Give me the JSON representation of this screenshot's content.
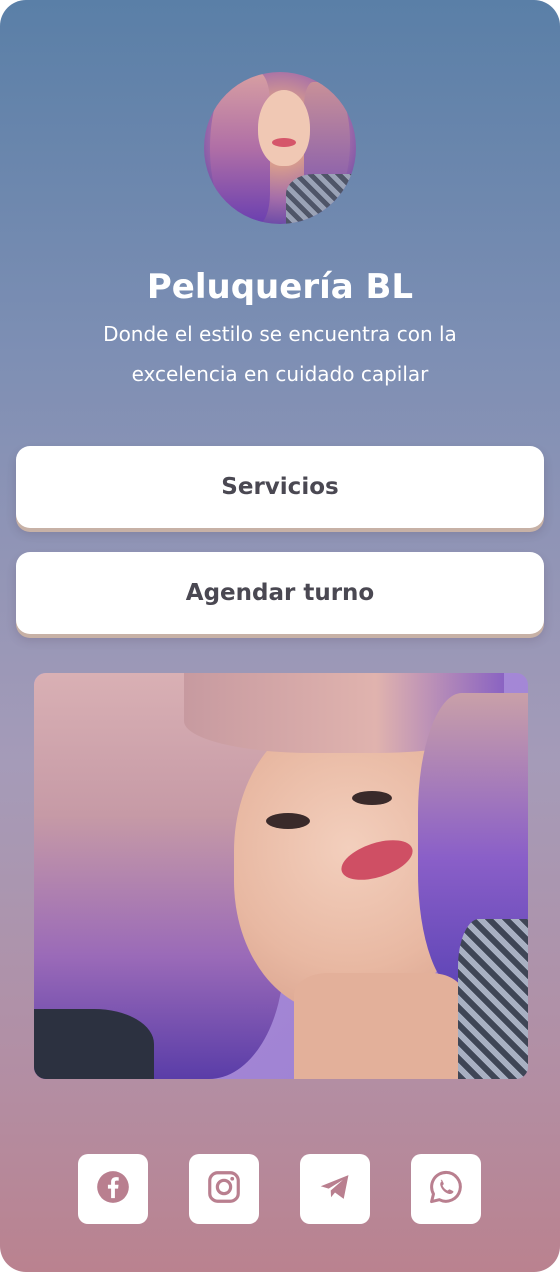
{
  "profile": {
    "name": "Peluquería BL",
    "description_line1": "Donde el estilo se encuentra con la",
    "description_line2": "excelencia en cuidado capilar",
    "avatar": "profile-photo"
  },
  "links": [
    {
      "label": "Servicios"
    },
    {
      "label": "Agendar turno"
    }
  ],
  "featured_image": "woman-with-pastel-pink-purple-hair",
  "social": [
    {
      "icon": "facebook-icon"
    },
    {
      "icon": "instagram-icon"
    },
    {
      "icon": "telegram-icon"
    },
    {
      "icon": "whatsapp-icon"
    }
  ],
  "colors": {
    "gradient_top": "#5a7fa7",
    "gradient_bottom": "#ba828f",
    "button_bg": "#ffffff",
    "button_text": "#4a4852",
    "icon_color": "#b97f8f"
  }
}
